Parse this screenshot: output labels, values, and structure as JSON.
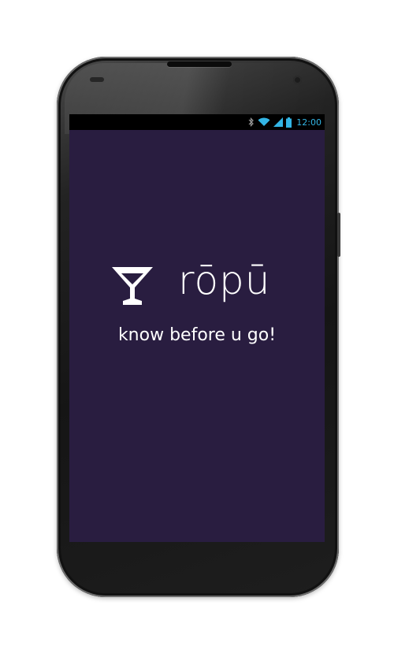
{
  "status_bar": {
    "time": "12:00",
    "icons": [
      "bluetooth-icon",
      "wifi-icon",
      "signal-icon",
      "battery-icon"
    ],
    "time_color": "#33b5e5"
  },
  "splash": {
    "app_name": "rōpū",
    "tagline": "know before u go!",
    "logo_icon": "cocktail-glass-icon",
    "background_color": "#291d40",
    "text_color": "#ffffff"
  }
}
